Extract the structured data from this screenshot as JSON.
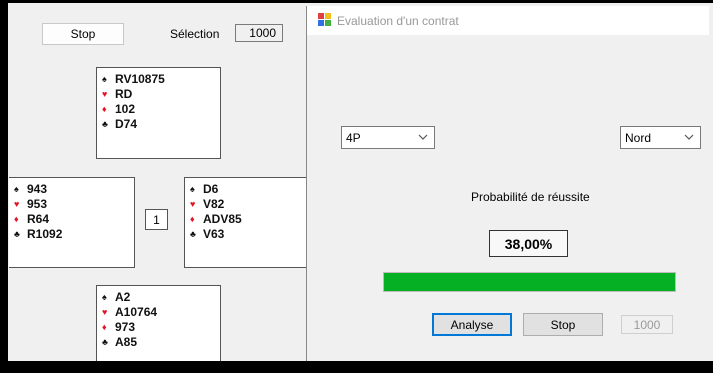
{
  "background_window": {
    "stop_label": "Stop",
    "selection_label": "Sélection",
    "selection_value": "1000",
    "counter_value": "1",
    "hands": {
      "north": [
        {
          "suit": "spade",
          "cards": "RV10875"
        },
        {
          "suit": "heart",
          "cards": "RD"
        },
        {
          "suit": "diamond",
          "cards": "102"
        },
        {
          "suit": "club",
          "cards": "D74"
        }
      ],
      "west": [
        {
          "suit": "spade",
          "cards": "943"
        },
        {
          "suit": "heart",
          "cards": "953"
        },
        {
          "suit": "diamond",
          "cards": "R64"
        },
        {
          "suit": "club",
          "cards": "R1092"
        }
      ],
      "east": [
        {
          "suit": "spade",
          "cards": "D6"
        },
        {
          "suit": "heart",
          "cards": "V82"
        },
        {
          "suit": "diamond",
          "cards": "ADV85"
        },
        {
          "suit": "club",
          "cards": "V63"
        }
      ],
      "south": [
        {
          "suit": "spade",
          "cards": "A2"
        },
        {
          "suit": "heart",
          "cards": "A10764"
        },
        {
          "suit": "diamond",
          "cards": "973"
        },
        {
          "suit": "club",
          "cards": "A85"
        }
      ]
    }
  },
  "suit_glyphs": {
    "spade": "♠",
    "heart": "♥",
    "diamond": "♦",
    "club": "♣"
  },
  "dialog": {
    "title": "Evaluation d'un contrat",
    "contract_select": "4P",
    "declarer_select": "Nord",
    "probability_label": "Probabilité de réussite",
    "probability_value": "38,00%",
    "progress_fraction": 1.0,
    "analyse_label": "Analyse",
    "stop_label": "Stop",
    "count_value": "1000"
  },
  "colors": {
    "progress_fill": "#06b025",
    "red_suit": "#e81123",
    "black_suit": "#111111"
  }
}
